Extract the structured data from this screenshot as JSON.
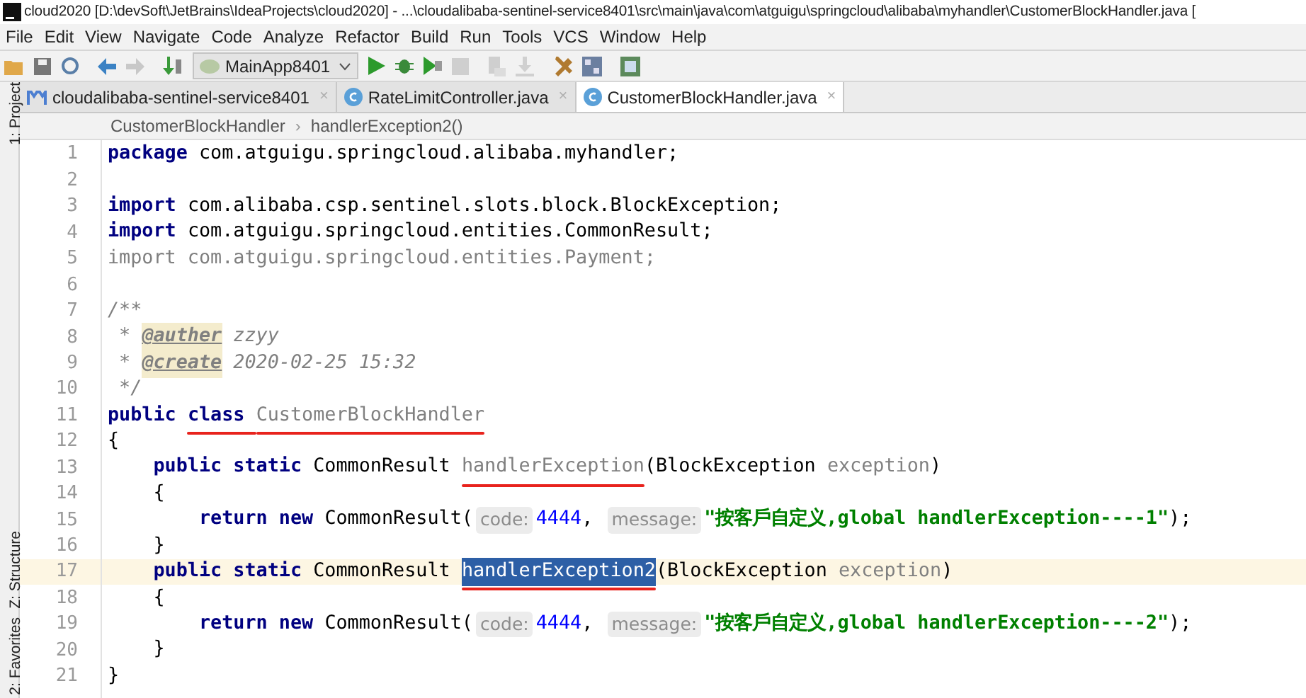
{
  "window": {
    "title": "cloud2020 [D:\\devSoft\\JetBrains\\IdeaProjects\\cloud2020] - ...\\cloudalibaba-sentinel-service8401\\src\\main\\java\\com\\atguigu\\springcloud\\alibaba\\myhandler\\CustomerBlockHandler.java ["
  },
  "menu": [
    "File",
    "Edit",
    "View",
    "Navigate",
    "Code",
    "Analyze",
    "Refactor",
    "Build",
    "Run",
    "Tools",
    "VCS",
    "Window",
    "Help"
  ],
  "toolbar": {
    "run_config": "MainApp8401"
  },
  "tabs": [
    {
      "label": "cloudalibaba-sentinel-service8401",
      "kind": "module",
      "close": "×",
      "selected": false
    },
    {
      "label": "RateLimitController.java",
      "kind": "class",
      "close": "×",
      "selected": false
    },
    {
      "label": "CustomerBlockHandler.java",
      "kind": "class",
      "close": "×",
      "selected": true
    }
  ],
  "breadcrumb": {
    "separator": "›",
    "items": [
      "CustomerBlockHandler",
      "handlerException2()"
    ]
  },
  "side_tools": [
    {
      "label": "1: Project",
      "kind": "top"
    },
    {
      "label": "Z: Structure",
      "kind": "bottom"
    },
    {
      "label": "2: Favorites",
      "kind": "bottom"
    }
  ],
  "code": [
    {
      "n": "1",
      "current": false,
      "tokens": [
        {
          "text": "package ",
          "kind": "keyword"
        },
        {
          "text": "com.atguigu.springcloud.alibaba.myhandler;",
          "kind": "plain"
        }
      ]
    },
    {
      "n": "2",
      "current": false
    },
    {
      "n": "3",
      "current": false,
      "tokens": [
        {
          "text": "import ",
          "kind": "keyword"
        },
        {
          "text": "com.alibaba.csp.sentinel.slots.block.BlockException;",
          "kind": "plain"
        }
      ]
    },
    {
      "n": "4",
      "current": false,
      "tokens": [
        {
          "text": "import ",
          "kind": "keyword"
        },
        {
          "text": "com.atguigu.springcloud.entities.CommonResult;",
          "kind": "plain"
        }
      ]
    },
    {
      "n": "5",
      "current": false,
      "tokens": [
        {
          "text": "import com.atguigu.springcloud.entities.Payment;",
          "kind": "unused"
        }
      ]
    },
    {
      "n": "6",
      "current": false
    },
    {
      "n": "7",
      "current": false,
      "tokens": [
        {
          "text": "/**",
          "kind": "comment"
        }
      ]
    },
    {
      "n": "8",
      "current": false,
      "tokens": [
        {
          "text": " * ",
          "kind": "comment"
        },
        {
          "text": "@auther",
          "kind": "doctag"
        },
        {
          "text": " zzyy",
          "kind": "docref"
        }
      ]
    },
    {
      "n": "9",
      "current": false,
      "tokens": [
        {
          "text": " * ",
          "kind": "comment"
        },
        {
          "text": "@create",
          "kind": "doctag"
        },
        {
          "text": " 2020-02-25 15:32",
          "kind": "comment"
        }
      ]
    },
    {
      "n": "10",
      "current": false,
      "tokens": [
        {
          "text": " */",
          "kind": "comment"
        }
      ]
    },
    {
      "n": "11",
      "current": false,
      "tokens": [
        {
          "text": "public ",
          "kind": "keyword"
        },
        {
          "text": "class ",
          "kind": "keyword",
          "underlined": true
        },
        {
          "text": "CustomerBlockHandler",
          "kind": "unused",
          "underlined": true
        }
      ]
    },
    {
      "n": "12",
      "current": false,
      "tokens": [
        {
          "text": "{",
          "kind": "plain"
        }
      ]
    },
    {
      "n": "13",
      "current": false,
      "tokens": [
        {
          "text": "    public static ",
          "kind": "keyword"
        },
        {
          "text": "CommonResult ",
          "kind": "plain"
        },
        {
          "text": "handlerException",
          "kind": "unused",
          "underlined": true
        },
        {
          "text": "(BlockException ",
          "kind": "plain"
        },
        {
          "text": "exception",
          "kind": "unused"
        },
        {
          "text": ")",
          "kind": "plain"
        }
      ]
    },
    {
      "n": "14",
      "current": false,
      "tokens": [
        {
          "text": "    {",
          "kind": "plain"
        }
      ]
    },
    {
      "n": "15",
      "current": false,
      "tokens": [
        {
          "text": "        return new ",
          "kind": "keyword"
        },
        {
          "text": "CommonResult(",
          "kind": "plain"
        },
        {
          "text": "code:",
          "kind": "hint"
        },
        {
          "text": "4444",
          "kind": "number"
        },
        {
          "text": ", ",
          "kind": "plain"
        },
        {
          "text": "message:",
          "kind": "hint"
        },
        {
          "text": "\"按客戶自定义,global handlerException----1\"",
          "kind": "string"
        },
        {
          "text": ");",
          "kind": "plain"
        }
      ]
    },
    {
      "n": "16",
      "current": false,
      "tokens": [
        {
          "text": "    }",
          "kind": "plain"
        }
      ]
    },
    {
      "n": "17",
      "current": true,
      "tokens": [
        {
          "text": "    public static ",
          "kind": "keyword"
        },
        {
          "text": "CommonResult ",
          "kind": "plain"
        },
        {
          "text": "handlerException2",
          "kind": "selected",
          "underlined": true
        },
        {
          "text": "(BlockException ",
          "kind": "plain"
        },
        {
          "text": "exception",
          "kind": "unused"
        },
        {
          "text": ")",
          "kind": "plain"
        }
      ]
    },
    {
      "n": "18",
      "current": false,
      "tokens": [
        {
          "text": "    {",
          "kind": "plain"
        }
      ]
    },
    {
      "n": "19",
      "current": false,
      "tokens": [
        {
          "text": "        return new ",
          "kind": "keyword"
        },
        {
          "text": "CommonResult(",
          "kind": "plain"
        },
        {
          "text": "code:",
          "kind": "hint"
        },
        {
          "text": "4444",
          "kind": "number"
        },
        {
          "text": ", ",
          "kind": "plain"
        },
        {
          "text": "message:",
          "kind": "hint"
        },
        {
          "text": "\"按客戶自定义,global handlerException----2\"",
          "kind": "string"
        },
        {
          "text": ");",
          "kind": "plain"
        }
      ]
    },
    {
      "n": "20",
      "current": false,
      "tokens": [
        {
          "text": "    }",
          "kind": "plain"
        }
      ]
    },
    {
      "n": "21",
      "current": false,
      "tokens": [
        {
          "text": "}",
          "kind": "plain"
        }
      ]
    }
  ]
}
